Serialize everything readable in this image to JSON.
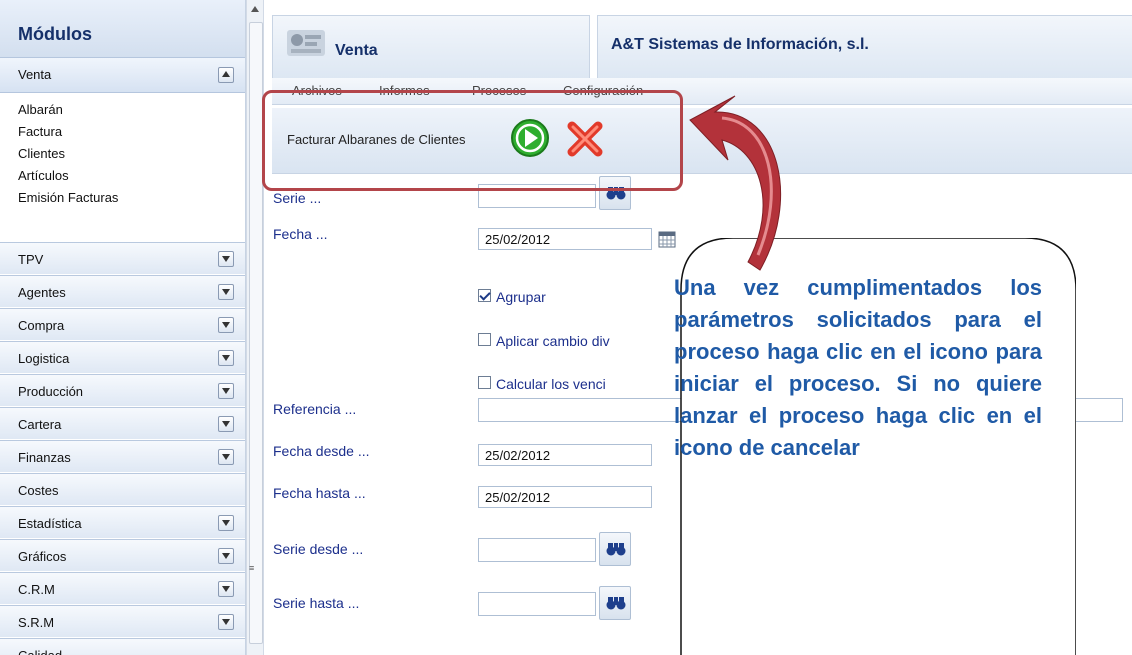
{
  "sidebar": {
    "title": "Módulos",
    "active_module": "Venta",
    "venta_items": [
      "Albarán",
      "Factura",
      "Clientes",
      "Artículos",
      "Emisión Facturas"
    ],
    "modules": [
      {
        "label": "TPV",
        "expandable": true
      },
      {
        "label": "Agentes",
        "expandable": true
      },
      {
        "label": "Compra",
        "expandable": true
      },
      {
        "label": "Logistica",
        "expandable": true
      },
      {
        "label": "Producción",
        "expandable": true
      },
      {
        "label": "Cartera",
        "expandable": true
      },
      {
        "label": "Finanzas",
        "expandable": true
      },
      {
        "label": "Costes",
        "expandable": false
      },
      {
        "label": "Estadística",
        "expandable": true
      },
      {
        "label": "Gráficos",
        "expandable": true
      },
      {
        "label": "C.R.M",
        "expandable": true
      },
      {
        "label": "S.R.M",
        "expandable": true
      },
      {
        "label": "Calidad",
        "expandable": false
      }
    ]
  },
  "header": {
    "module_title": "Venta",
    "company": "A&T Sistemas de Información, s.l."
  },
  "menu": [
    "Archivos",
    "Informes",
    "Procesos",
    "Configuración"
  ],
  "toolbar": {
    "label": "Facturar Albaranes de Clientes"
  },
  "form": {
    "serie_label": "Serie ...",
    "serie_value": "",
    "fecha_label": "Fecha ...",
    "fecha_value": "25/02/2012",
    "agrupar_label": "Agrupar",
    "agrupar_checked": true,
    "aplicar_label": "Aplicar cambio div",
    "aplicar_checked": false,
    "calcular_label": "Calcular los venci",
    "calcular_checked": false,
    "referencia_label": "Referencia ...",
    "referencia_value": "",
    "fecha_desde_label": "Fecha desde ...",
    "fecha_desde_value": "25/02/2012",
    "fecha_hasta_label": "Fecha hasta ...",
    "fecha_hasta_value": "25/02/2012",
    "serie_desde_label": "Serie desde ...",
    "serie_desde_value": "",
    "serie_hasta_label": "Serie hasta ...",
    "serie_hasta_value": ""
  },
  "callout": {
    "text": "Una vez cumplimentados los parámetros solicitados para el proceso haga clic en el icono para iniciar el proceso. Si no quiere lanzar el proceso haga clic en el icono de cancelar"
  },
  "colors": {
    "highlight": "#b3454a",
    "callout_arrow": "#b3323a",
    "callout_text": "#1f5aa6",
    "ok_green": "#2fae2f",
    "cancel_red": "#e23a2a"
  }
}
